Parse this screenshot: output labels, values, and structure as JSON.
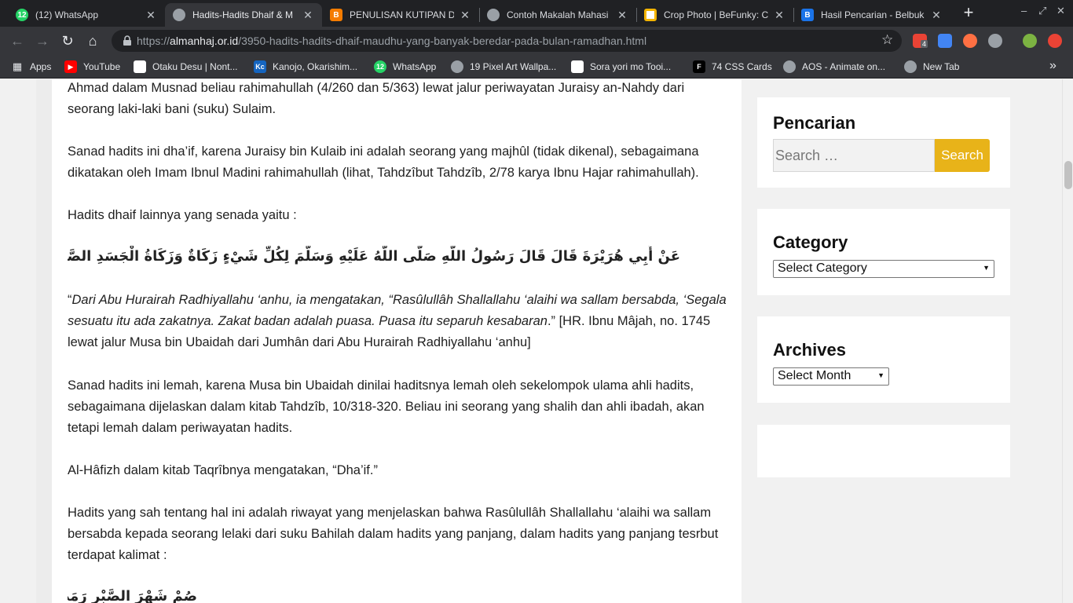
{
  "tabs": [
    {
      "title": "(12) WhatsApp",
      "icon": "whatsapp-icon",
      "active": false
    },
    {
      "title": "Hadits-Hadits Dhaif & M",
      "icon": "globe-icon",
      "active": true
    },
    {
      "title": "PENULISAN KUTIPAN DA",
      "icon": "blogger-icon",
      "active": false
    },
    {
      "title": "Contoh Makalah Mahasi",
      "icon": "globe-icon",
      "active": false
    },
    {
      "title": "Crop Photo | BeFunky: C",
      "icon": "befunky-icon",
      "active": false
    },
    {
      "title": "Hasil Pencarian - Belbuk",
      "icon": "bootstrap-b-icon",
      "active": false
    }
  ],
  "toolbar": {
    "url_scheme": "https://",
    "url_host": "almanhaj.or.id",
    "url_path": "/3950-hadits-hadits-dhaif-maudhu-yang-banyak-beredar-pada-bulan-ramadhan.html",
    "extension_badge": "4"
  },
  "bookmarks": [
    {
      "label": "Apps",
      "icon": "apps-grid-icon"
    },
    {
      "label": "YouTube",
      "icon": "youtube-icon"
    },
    {
      "label": "Otaku Desu | Nont...",
      "icon": "page-icon"
    },
    {
      "label": "Kanojo, Okarishim...",
      "icon": "kc-icon"
    },
    {
      "label": "WhatsApp",
      "icon": "whatsapp-icon"
    },
    {
      "label": "19 Pixel Art Wallpa...",
      "icon": "globe-icon"
    },
    {
      "label": "Sora yori mo Tooi...",
      "icon": "page-icon"
    },
    {
      "label": "74 CSS Cards",
      "icon": "f-icon"
    },
    {
      "label": "AOS - Animate on...",
      "icon": "globe-icon"
    },
    {
      "label": "New Tab",
      "icon": "globe-icon"
    }
  ],
  "article": {
    "p1": "Ahmad dalam Musnad beliau rahimahullah (4/260 dan 5/363) lewat jalur periwayatan Juraisy an-Nahdy dari seorang laki-laki bani (suku) Sulaim.",
    "p2": "Sanad hadits ini dha’if, karena Juraisy bin Kulaib ini adalah seorang yang majhûl (tidak dikenal), sebagaimana dikatakan oleh Imam Ibnul Madini rahimahullah (lihat, Tahdzîbut Tahdzîb, 2/78 karya Ibnu Hajar rahimahullah).",
    "p3": "Hadits dhaif lainnya yang senada yaitu :",
    "arabic1": "عَنْ أَبِي هُرَيْرَةَ قَالَ قَالَ رَسُولُ اللَّهِ صَلَّى اللَّهُ عَلَيْهِ وَسَلَّمَ لِكُلِّ شَيْءٍ زَكَاةٌ وَزَكَاةُ الْجَسَدِ الصَّوْمُ , الصِّيَامُ نِصْفُ الصَّبْرِ",
    "p4_open": "“",
    "p4_italic": "Dari Abu Hurairah Radhiyallahu ‘anhu, ia mengatakan, “Rasûlullâh Shallallahu ‘alaihi wa sallam bersabda, ‘Segala sesuatu itu ada zakatnya. Zakat badan adalah puasa. Puasa itu separuh kesabaran",
    "p4_rest": ".” [HR. Ibnu Mâjah, no. 1745 lewat jalur Musa bin Ubaidah dari Jumhân dari Abu Hurairah Radhiyallahu ‘anhu]",
    "p5": "Sanad hadits ini lemah, karena Musa bin Ubaidah dinilai haditsnya lemah oleh sekelompok ulama ahli hadits, sebagaimana dijelaskan dalam kitab Tahdzîb, 10/318-320. Beliau ini seorang yang shalih dan ahli ibadah, akan tetapi lemah dalam periwayatan hadits.",
    "p6": "Al-Hâfizh dalam kitab Taqrîbnya mengatakan, “Dha’if.”",
    "p7": "Hadits yang sah tentang hal ini adalah riwayat yang menjelaskan bahwa Rasûlullâh Shallallahu ‘alaihi wa sallam bersabda kepada seorang lelaki dari suku Bahilah dalam hadits yang panjang, dalam hadits yang panjang tesrbut terdapat kalimat :",
    "arabic2": "صُمْ شَهْرَ الصَّبْرِ رَمَضَانَ"
  },
  "sidebar": {
    "search_title": "Pencarian",
    "search_placeholder": "Search …",
    "search_button": "Search",
    "category_title": "Category",
    "category_selected": "Select Category",
    "archives_title": "Archives",
    "archives_selected": "Select Month"
  },
  "colors": {
    "search_button": "#e8b319",
    "chrome_dark": "#202124",
    "chrome_toolbar": "#35363a"
  }
}
